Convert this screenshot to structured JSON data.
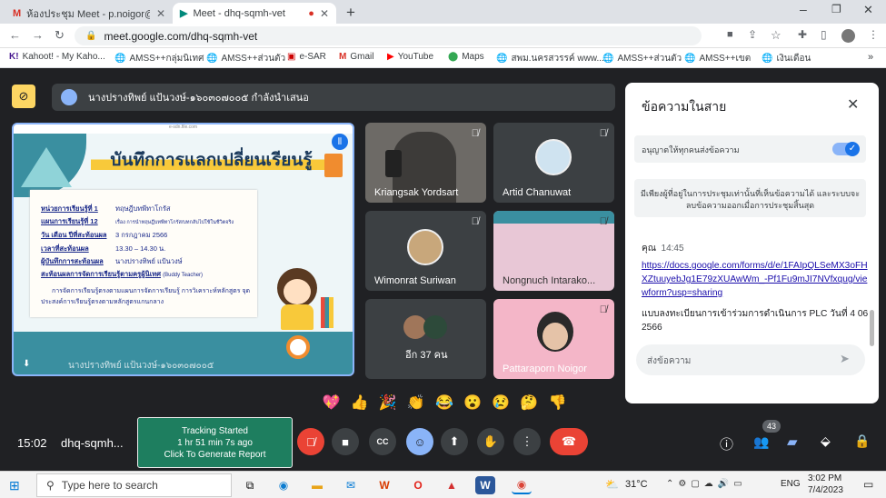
{
  "tabs": [
    {
      "title": "ห้องประชุม Meet - p.noigor@gmai"
    },
    {
      "title": "Meet - dhq-sqmh-vet"
    }
  ],
  "url": "meet.google.com/dhq-sqmh-vet",
  "bookmarks": [
    "Kahoot! - My Kaho...",
    "AMSS++กลุ่มนิเทศ",
    "AMSS++ส่วนตัว",
    "e-SAR",
    "Gmail",
    "YouTube",
    "Maps",
    "สพม.นครสวรรค์ www....",
    "AMSS++ส่วนตัว",
    "AMSS++เขต",
    "เงินเดือน"
  ],
  "presenter": "นางปรางทิพย์ แป้นวงษ์-๑๖๐๓๐๗๐๐๕ กำลังนำเสนอ",
  "slide": {
    "site": "e-sdn.file.com",
    "title": "บันทึกการแลกเปลี่ยนเรียนรู้",
    "rows": [
      {
        "label": "หน่วยการเรียนรู้ที่ 1",
        "value": "ทฤษฎีบทพีทาโกรัส"
      },
      {
        "label": "แผนการเรียนรู้ที่ 12",
        "value": "เรื่อง การนำทฤษฎีบทพีทาโกรัส/บทกลับไปใช้ในชีวิตจริง"
      },
      {
        "label": "วัน เดือน ปีที่สะท้อนผล",
        "value": "3 กรกฎาคม 2566"
      },
      {
        "label": "เวลาที่สะท้อนผล",
        "value": "13.30 – 14.30 น."
      },
      {
        "label": "ผู้บันทึกการสะท้อนผล",
        "value": "นางปรางทิพย์   แป้นวงษ์"
      }
    ],
    "method_label": "สะท้อนผลการจัดการเรียนรู้ตามครูผู้นิเทศ",
    "method_value": "(Buddy Teacher)",
    "body": "การจัดการเรียนรู้ตรงตามแผนการจัดการเรียนรู้ การวิเคราะห์หลักสูตร จุดประสงค์การเรียนรู้ตรงตามหลักสูตรแกนกลาง",
    "footer": "นางปรางทิพย์ แป้นวงษ์-๑๖๐๓๐๗๐๐๕"
  },
  "participants": [
    {
      "name": "Kriangsak Yordsart"
    },
    {
      "name": "Artid Chanuwat"
    },
    {
      "name": "Wimonrat Suriwan"
    },
    {
      "name": "Nongnuch Intarako..."
    },
    {
      "name": "อีก 37 คน"
    },
    {
      "name": "Pattaraporn Noigor"
    }
  ],
  "chat": {
    "title": "ข้อความในสาย",
    "toggle_label": "อนุญาตให้ทุกคนส่งข้อความ",
    "notice": "มีเพียงผู้ที่อยู่ในการประชุมเท่านั้นที่เห็นข้อความได้ และระบบจะลบข้อความออกเมื่อการประชุมสิ้นสุด",
    "sender": "คุณ",
    "time": "14:45",
    "link": "https://docs.google.com/forms/d/e/1FAIpQLSeMX3oFHXZtuuyebJg1E79zXUAwWm_-Pf1Fu9mJI7NVfxqug/viewform?usp=sharing",
    "message": "แบบลงทะเบียนการเข้าร่วมการดำเนินการ PLC วันที่ 4 06 2566",
    "placeholder": "ส่งข้อความ"
  },
  "reactions": [
    "💖",
    "👍",
    "🎉",
    "👏",
    "😂",
    "😮",
    "😢",
    "🤔",
    "👎"
  ],
  "bottom": {
    "time": "15:02",
    "code": "dhq-sqmh...",
    "tracking_line1": "Tracking Started",
    "tracking_line2": "1 hr 51 min 7s ago",
    "tracking_line3": "Click To Generate Report",
    "people_count": "43"
  },
  "taskbar": {
    "search": "Type here to search",
    "temp": "31°C",
    "lang": "ENG",
    "clock_time": "3:02 PM",
    "clock_date": "7/4/2023"
  }
}
